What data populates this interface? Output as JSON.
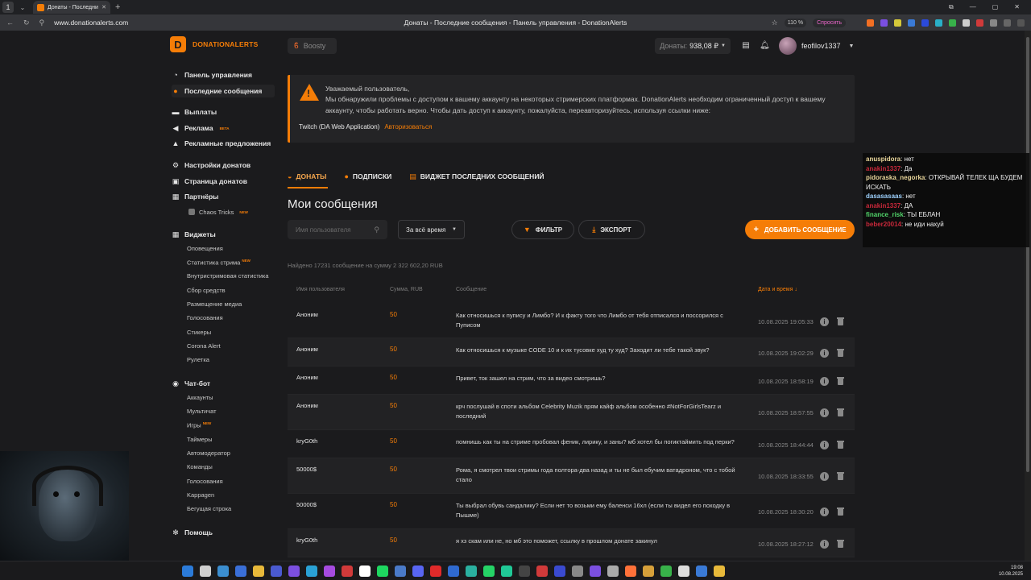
{
  "browser": {
    "workspace": "1",
    "tab_title": "Донаты - Последние с",
    "url": "www.donationalerts.com",
    "page_title": "Донаты - Последние сообщения - Панель управления - DonationAlerts",
    "zoom": "110 %",
    "ask_label": "Спросить"
  },
  "header": {
    "logo_text": "DONATIONALERTS",
    "boosty_label": "Boosty",
    "donations_label": "Донаты:",
    "donations_value": "938,08 ₽",
    "username": "feofilov1337"
  },
  "sidebar": {
    "items": [
      {
        "label": "Панель управления"
      },
      {
        "label": "Последние сообщения"
      },
      {
        "label": "Выплаты"
      },
      {
        "label": "Реклама",
        "badge": "BETA"
      },
      {
        "label": "Рекламные предложения"
      },
      {
        "label": "Настройки донатов"
      },
      {
        "label": "Страница донатов"
      },
      {
        "label": "Партнёры"
      },
      {
        "label": "Виджеты"
      },
      {
        "label": "Чат-бот"
      },
      {
        "label": "Помощь"
      }
    ],
    "sub": [
      {
        "label": "Chaos Tricks",
        "badge": "NEW"
      },
      {
        "label": "Оповещения"
      },
      {
        "label": "Статистика стрима",
        "badge": "NEW"
      },
      {
        "label": "Внутристримовая статистика"
      },
      {
        "label": "Сбор средств"
      },
      {
        "label": "Размещение медиа"
      },
      {
        "label": "Голосования"
      },
      {
        "label": "Стикеры"
      },
      {
        "label": "Corona Alert"
      },
      {
        "label": "Рулетка"
      },
      {
        "label": "Аккаунты"
      },
      {
        "label": "Мультичат"
      },
      {
        "label": "Игры",
        "badge": "NEW"
      },
      {
        "label": "Таймеры"
      },
      {
        "label": "Автомодератор"
      },
      {
        "label": "Команды"
      },
      {
        "label": "Голосования"
      },
      {
        "label": "Kappagen"
      },
      {
        "label": "Бегущая строка"
      }
    ]
  },
  "alert": {
    "line1": "Уважаемый пользователь,",
    "line2": "Мы обнаружили проблемы с доступом к вашему аккаунту на некоторых стримерских платформах. DonationAlerts необходим ограниченный доступ к вашему аккаунту, чтобы работать верно. Чтобы дать доступ к аккаунту, пожалуйста, переавторизуйтесь, используя ссылки ниже:",
    "platform": "Twitch (DA Web Application)",
    "auth_link": "Авторизоваться"
  },
  "tabs": [
    {
      "label": "ДОНАТЫ"
    },
    {
      "label": "ПОДПИСКИ"
    },
    {
      "label": "ВИДЖЕТ ПОСЛЕДНИХ СООБЩЕНИЙ"
    }
  ],
  "main": {
    "title": "Мои сообщения",
    "search_placeholder": "Имя пользователя",
    "period": "За всё время",
    "filter_label": "ФИЛЬТР",
    "export_label": "ЭКСПОРТ",
    "add_label": "ДОБАВИТЬ СООБЩЕНИЕ",
    "found": "Найдено 17231 сообщение на сумму 2 322 602,20 RUB"
  },
  "table": {
    "headers": {
      "user": "Имя пользователя",
      "amount": "Сумма, RUB",
      "message": "Сообщение",
      "date": "Дата и время ↓"
    },
    "rows": [
      {
        "user": "Аноним",
        "amount": "50",
        "message": "Как относишься к пупису и Лимбо? И к факту того что Лимбо от тебя отписался и поссорился с Пуписом",
        "date": "10.08.2025 19:05:33"
      },
      {
        "user": "Аноним",
        "amount": "50",
        "message": "Как относишься к музыке CODE 10 и к их тусовке худ ту худ? Заходит ли тебе такой звук?",
        "date": "10.08.2025 19:02:29"
      },
      {
        "user": "Аноним",
        "amount": "50",
        "message": "Привет, ток зашел на стрим, что за видео смотришь?",
        "date": "10.08.2025 18:58:19"
      },
      {
        "user": "Аноним",
        "amount": "50",
        "message": "крч послушай в спoти альбом Celebrity Muzik прям кайф альбом особенно #NotForGirlsTearz и последний",
        "date": "10.08.2025 18:57:55"
      },
      {
        "user": "kryG0th",
        "amount": "50",
        "message": "помнишь как ты на стриме пробовал феник, лирику, и заны? мб хотел бы погиктаймить под перки?",
        "date": "10.08.2025 18:44:44"
      },
      {
        "user": "50000$",
        "amount": "50",
        "message": "Рома, я смотрел твои стримы года полтора-два назад и ты не был ебучим ватадроном, что с тобой стало",
        "date": "10.08.2025 18:33:55"
      },
      {
        "user": "50000$",
        "amount": "50",
        "message": "Ты выбрал обувь сандалику? Если нет то возьми ему баленси 16хл (если ты видел его походку в Пышме)",
        "date": "10.08.2025 18:30:20"
      },
      {
        "user": "kryG0th",
        "amount": "50",
        "message": "я хз скам или не, но мб это поможет, ссылку в прошлом донате закинул",
        "date": "10.08.2025 18:27:12"
      }
    ]
  },
  "chat": [
    {
      "user": "anuspidora",
      "text": "нет",
      "color": "#e8d59a"
    },
    {
      "user": "anakin1337",
      "text": "Да",
      "color": "#c8283a"
    },
    {
      "user": "pidoraska_negorka",
      "text": "ОТКРЫВАЙ ТЕЛЕК ЩА БУДЕМ ИСКАТЬ",
      "color": "#e8d59a"
    },
    {
      "user": "dasasasaas",
      "text": "нет",
      "color": "#9fd3ff"
    },
    {
      "user": "anakin1337",
      "text": "ДА",
      "color": "#c8283a"
    },
    {
      "user": "finance_risk",
      "text": "ТЫ ЕБЛАН",
      "color": "#52d66b"
    },
    {
      "user": "beber20014",
      "text": "не иди нахуй",
      "color": "#c8283a"
    }
  ],
  "taskbar": {
    "time": "19:08",
    "date": "10.08.2025"
  },
  "colors": {
    "accent": "#f57d07",
    "bg": "#1b1b1d",
    "panel": "#242426"
  }
}
